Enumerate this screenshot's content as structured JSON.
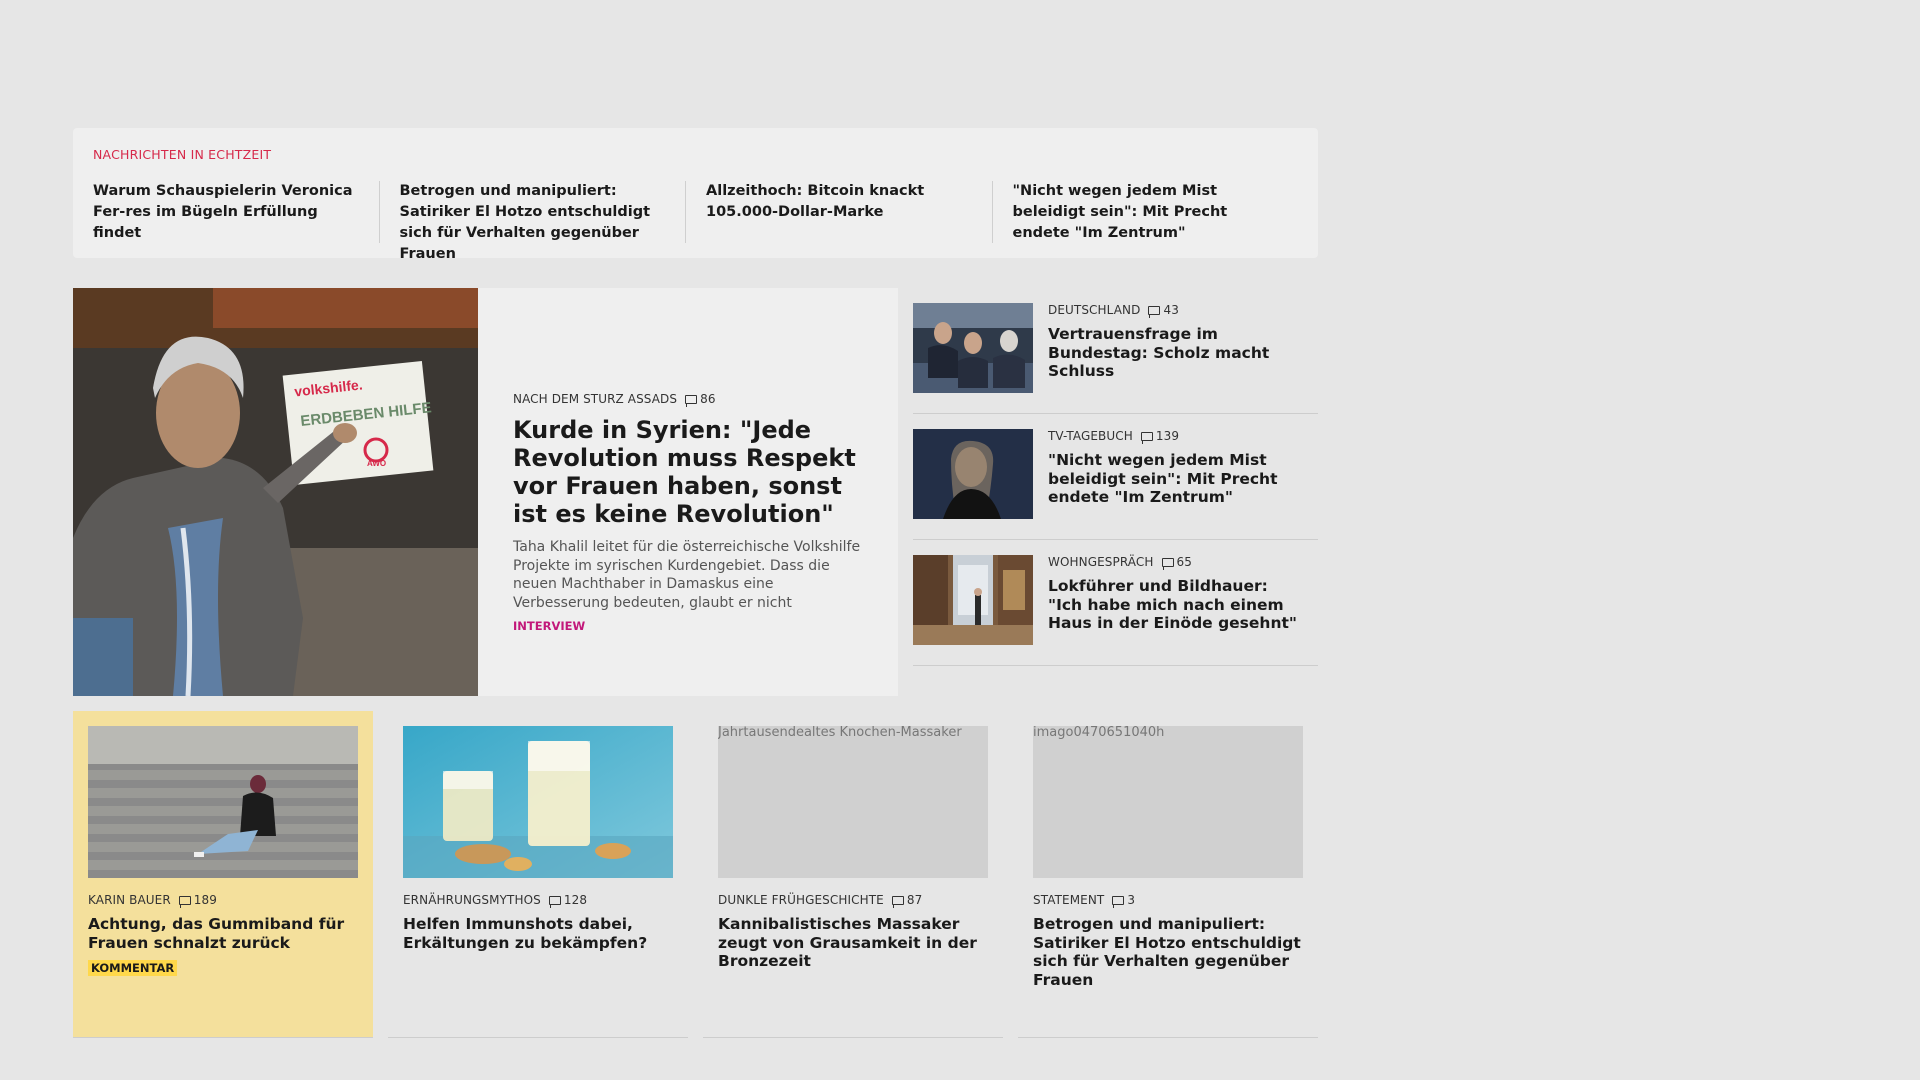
{
  "ticker": {
    "heading": "NACHRICHTEN IN ECHTZEIT",
    "items": [
      "Warum Schauspielerin Veronica Fer-res im Bügeln Erfüllung findet",
      "Betrogen und manipuliert: Satiriker El Hotzo entschuldigt sich für Verhalten gegenüber Frauen",
      "Allzeithoch: Bitcoin knackt 105.000-Dollar-Marke",
      "\"Nicht wegen jedem Mist beleidigt sein\": Mit Precht endete \"Im Zentrum\""
    ]
  },
  "hero": {
    "kicker": "NACH DEM STURZ ASSADS",
    "comments": "86",
    "title": "Kurde in Syrien: \"Jede Revolution muss Respekt vor Frauen haben, sonst ist es keine Revolution\"",
    "teaser": "Taha Khalil leitet für die österreichische Volkshilfe Projekte im syrischen Kurdengebiet. Dass die neuen Machthaber in Damaskus eine Verbesserung bedeuten, glaubt er nicht",
    "tag": "INTERVIEW",
    "sign": {
      "brand": "volkshilfe.",
      "line": "ERDBEBEN HILFE",
      "awo": "AWO"
    }
  },
  "side": [
    {
      "kicker": "DEUTSCHLAND",
      "comments": "43",
      "title": "Vertrauensfrage im Bundestag: Scholz macht Schluss"
    },
    {
      "kicker": "TV-TAGEBUCH",
      "comments": "139",
      "title": "\"Nicht wegen jedem Mist beleidigt sein\": Mit Precht endete \"Im Zentrum\""
    },
    {
      "kicker": "WOHNGESPRÄCH",
      "comments": "65",
      "title": "Lokführer und Bildhauer: \"Ich habe mich nach einem Haus in der Einöde gesehnt\""
    }
  ],
  "cards": [
    {
      "kicker": "KARIN BAUER",
      "comments": "189",
      "title": "Achtung, das Gummiband für Frauen schnalzt zurück",
      "tag": "KOMMENTAR"
    },
    {
      "kicker": "ERNÄHRUNGSMYTHOS",
      "comments": "128",
      "title": "Helfen Immunshots dabei, Erkältungen zu bekämpfen?"
    },
    {
      "kicker": "DUNKLE FRÜHGESCHICHTE",
      "comments": "87",
      "title": "Kannibalistisches Massaker zeugt von Grausamkeit in der Bronzezeit",
      "img_alt": "Jahrtausendealtes Knochen-Massaker"
    },
    {
      "kicker": "STATEMENT",
      "comments": "3",
      "title": "Betrogen und manipuliert: Satiriker El Hotzo entschuldigt sich für Verhalten gegenüber Frauen",
      "img_alt": "imago0470651040h"
    }
  ]
}
